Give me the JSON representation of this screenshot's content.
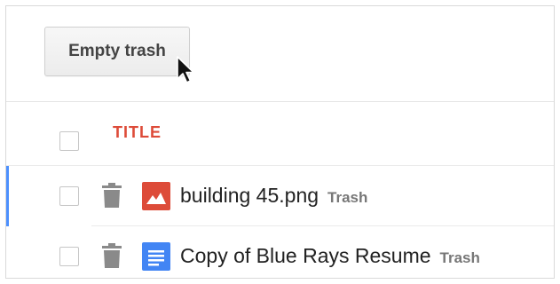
{
  "toolbar": {
    "empty_trash_label": "Empty trash"
  },
  "list": {
    "column_title": "TITLE",
    "items": [
      {
        "name": "building 45.png",
        "tag": "Trash",
        "type": "image-icon",
        "selected": true
      },
      {
        "name": "Copy of Blue Rays Resume",
        "tag": "Trash",
        "type": "document-icon",
        "selected": false
      }
    ]
  },
  "colors": {
    "title_red": "#dd4b39",
    "selection_blue": "#4d90fe",
    "image_icon_red": "#dd4b39",
    "doc_icon_blue": "#4285f4"
  }
}
